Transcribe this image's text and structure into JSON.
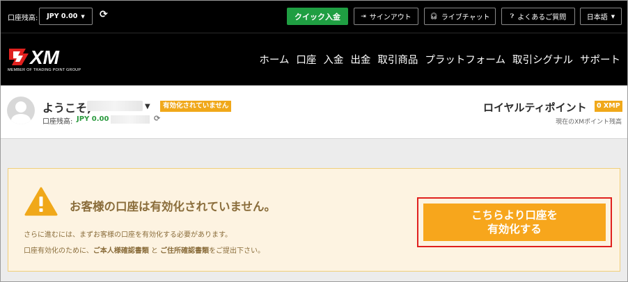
{
  "topbar": {
    "balance_label": "口座残高:",
    "balance_value": "JPY 0.00",
    "deposit_label": "クイック入金",
    "signout_label": "サインアウト",
    "chat_label": "ライブチャット",
    "faq_label": "よくあるご質問",
    "language_label": "日本語"
  },
  "logo": {
    "text": "XM",
    "tagline": "MEMBER OF TRADING POINT GROUP",
    "accent_color": "#e0201e"
  },
  "nav": {
    "items": [
      "ホーム",
      "口座",
      "入金",
      "出金",
      "取引商品",
      "プラットフォーム",
      "取引シグナル",
      "サポート"
    ]
  },
  "user": {
    "welcome": "ようこそ,",
    "status_badge": "有効化されていません",
    "balance_label": "口座残高:",
    "balance_value": "JPY 0.00"
  },
  "loyalty": {
    "title": "ロイヤルティポイント",
    "points": "0 XMP",
    "subtitle": "現在のXMポイント残高"
  },
  "alert": {
    "title": "お客様の口座は有効化されていません。",
    "line1": "さらに進むには、まずお客様の口座を有効化する必要があります。",
    "line2_prefix": "口座有効化のために、",
    "line2_doc1": "ご本人様確認書類",
    "line2_mid": " と ",
    "line2_doc2": "ご住所確認書類",
    "line2_suffix": "をご提出下さい。",
    "button_line1": "こちらより口座を",
    "button_line2": "有効化する"
  },
  "colors": {
    "deposit_green": "#1f9e42",
    "badge_orange": "#f0a81a",
    "button_orange": "#f7a61c",
    "highlight_red": "#e0201e",
    "alert_text": "#8a6d3b"
  }
}
